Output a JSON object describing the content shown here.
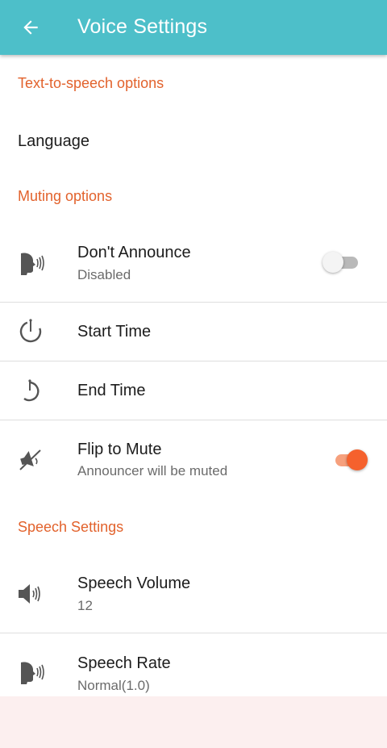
{
  "appbar": {
    "title": "Voice Settings",
    "back_icon": "arrow-left-icon",
    "color": "#4dbfc9"
  },
  "accent_color": "#e2622c",
  "sections": {
    "tts": {
      "header": "Text-to-speech options",
      "language_label": "Language"
    },
    "muting": {
      "header": "Muting options",
      "dont_announce": {
        "title": "Don't Announce",
        "subtitle": "Disabled",
        "icon": "speaking-head-icon",
        "enabled": false
      },
      "start_time": {
        "title": "Start Time",
        "icon": "timer-start-icon"
      },
      "end_time": {
        "title": "End Time",
        "icon": "timer-end-icon"
      },
      "flip_to_mute": {
        "title": "Flip to Mute",
        "subtitle": "Announcer will be muted",
        "icon": "phone-muted-icon",
        "enabled": true
      }
    },
    "speech": {
      "header": "Speech Settings",
      "volume": {
        "title": "Speech Volume",
        "value": "12",
        "icon": "speaker-icon"
      },
      "rate": {
        "title": "Speech Rate",
        "value": "Normal(1.0)",
        "icon": "speaking-head-icon"
      }
    }
  }
}
